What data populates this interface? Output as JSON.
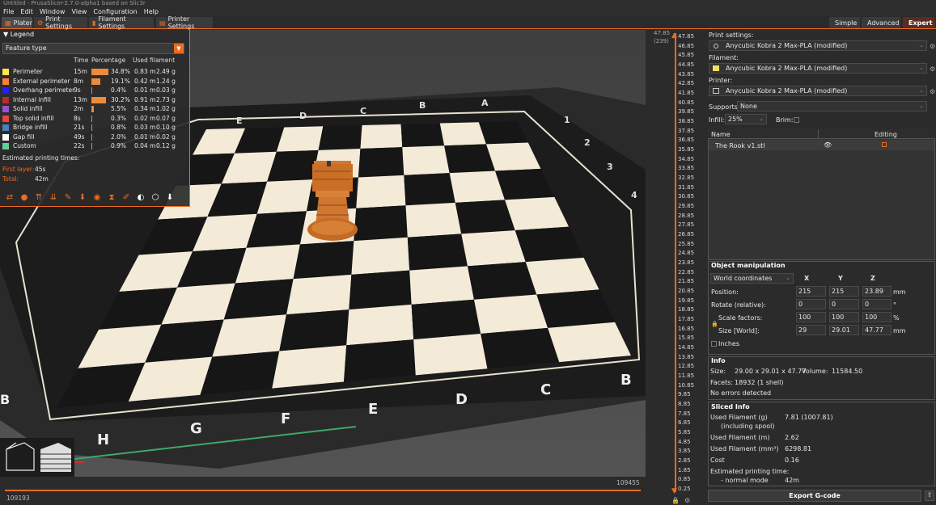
{
  "window": {
    "title": "Untitled - PrusaSlicer-2.7.0-alpha1 based on Slic3r"
  },
  "menu": [
    "File",
    "Edit",
    "Window",
    "View",
    "Configuration",
    "Help"
  ],
  "tabs": [
    {
      "label": "Plater",
      "active": true
    },
    {
      "label": "Print Settings",
      "active": false
    },
    {
      "label": "Filament Settings",
      "active": false
    },
    {
      "label": "Printer Settings",
      "active": false
    }
  ],
  "modes": {
    "simple": "Simple",
    "advanced": "Advanced",
    "expert": "Expert"
  },
  "legend": {
    "title": "Legend",
    "view_type": "Feature type",
    "columns": {
      "time": "Time",
      "percentage": "Percentage",
      "used": "Used filament"
    },
    "rows": [
      {
        "name": "Perimeter",
        "time": "15m",
        "pct": "34.8%",
        "pct_value": 34.8,
        "m": "0.83 m",
        "g": "2.49 g",
        "color": "#FFE64D"
      },
      {
        "name": "External perimeter",
        "time": "8m",
        "pct": "19.1%",
        "pct_value": 19.1,
        "m": "0.42 m",
        "g": "1.24 g",
        "color": "#FF7D38"
      },
      {
        "name": "Overhang perimeter",
        "time": "9s",
        "pct": "0.4%",
        "pct_value": 0.4,
        "m": "0.01 m",
        "g": "0.03 g",
        "color": "#1F1FFF"
      },
      {
        "name": "Internal infill",
        "time": "13m",
        "pct": "30.2%",
        "pct_value": 30.2,
        "m": "0.91 m",
        "g": "2.73 g",
        "color": "#B03029"
      },
      {
        "name": "Solid infill",
        "time": "2m",
        "pct": "5.5%",
        "pct_value": 5.5,
        "m": "0.34 m",
        "g": "1.02 g",
        "color": "#9654CC"
      },
      {
        "name": "Top solid infill",
        "time": "8s",
        "pct": "0.3%",
        "pct_value": 0.3,
        "m": "0.02 m",
        "g": "0.07 g",
        "color": "#F04040"
      },
      {
        "name": "Bridge infill",
        "time": "21s",
        "pct": "0.8%",
        "pct_value": 0.8,
        "m": "0.03 m",
        "g": "0.10 g",
        "color": "#4D80BA"
      },
      {
        "name": "Gap fill",
        "time": "49s",
        "pct": "2.0%",
        "pct_value": 2.0,
        "m": "0.01 m",
        "g": "0.02 g",
        "color": "#FFFFFF"
      },
      {
        "name": "Custom",
        "time": "22s",
        "pct": "0.9%",
        "pct_value": 0.9,
        "m": "0.04 m",
        "g": "0.12 g",
        "color": "#5ED194"
      }
    ],
    "estimated_title": "Estimated printing times:",
    "first_layer_label": "First layer:",
    "first_layer_value": "45s",
    "total_label": "Total:",
    "total_value": "42m"
  },
  "board_letters_top": [
    "E",
    "D",
    "C",
    "B",
    "A"
  ],
  "board_numbers_right": [
    "1",
    "2",
    "3",
    "4"
  ],
  "board_letters_bottom": [
    "H",
    "G",
    "F",
    "E",
    "D",
    "C",
    "B"
  ],
  "board_left": [
    "B",
    "F"
  ],
  "layer_slider": {
    "top_value": "47.85",
    "top_layer": "(239)",
    "ticks": [
      "47.85",
      "46.85",
      "45.85",
      "44.85",
      "43.85",
      "42.85",
      "41.85",
      "40.85",
      "39.85",
      "38.85",
      "37.85",
      "36.85",
      "35.85",
      "34.85",
      "33.85",
      "32.85",
      "31.85",
      "30.85",
      "29.85",
      "28.85",
      "27.85",
      "26.85",
      "25.85",
      "24.85",
      "23.85",
      "22.85",
      "21.85",
      "20.85",
      "19.85",
      "18.85",
      "17.85",
      "16.85",
      "15.85",
      "14.85",
      "13.85",
      "12.85",
      "11.85",
      "10.85",
      "9.85",
      "8.85",
      "7.85",
      "6.85",
      "5.85",
      "4.85",
      "3.85",
      "2.85",
      "1.85",
      "0.85",
      "0.25"
    ],
    "bottom_value": "0.25"
  },
  "move_slider": {
    "left": "109193",
    "right": "109455"
  },
  "right_panel": {
    "print_settings_label": "Print settings:",
    "print_settings_value": "Anycubic Kobra 2 Max-PLA (modified)",
    "filament_label": "Filament:",
    "filament_value": "Anycubic Kobra 2 Max-PLA (modified)",
    "printer_label": "Printer:",
    "printer_value": "Anycubic Kobra 2 Max-PLA (modified)",
    "supports_label": "Supports:",
    "supports_value": "None",
    "infill_label": "Infill:",
    "infill_value": "25%",
    "brim_label": "Brim:",
    "list_cols": {
      "name": "Name",
      "editing": "Editing"
    },
    "objects": [
      "The Rook v1.stl"
    ],
    "object_manipulation": {
      "title": "Object manipulation",
      "coords": "World coordinates",
      "axes": [
        "X",
        "Y",
        "Z"
      ],
      "position_label": "Position:",
      "position": [
        "215",
        "215",
        "23.89"
      ],
      "position_unit": "mm",
      "rotate_label": "Rotate (relative):",
      "rotate": [
        "0",
        "0",
        "0"
      ],
      "rotate_unit": "°",
      "scale_label": "Scale factors:",
      "scale": [
        "100",
        "100",
        "100"
      ],
      "scale_unit": "%",
      "size_label": "Size [World]:",
      "size": [
        "29",
        "29.01",
        "47.77"
      ],
      "size_unit": "mm",
      "inches_label": "Inches"
    },
    "info": {
      "title": "Info",
      "size_label": "Size:",
      "size_value": "29.00 x 29.01 x 47.77",
      "volume_label": "Volume:",
      "volume_value": "11584.50",
      "facets_label": "Facets:",
      "facets_value": "18932 (1 shell)",
      "errors": "No errors detected"
    },
    "sliced_info": {
      "title": "Sliced Info",
      "rows": [
        {
          "label": "Used Filament (g)",
          "value": "7.81 (1007.81)"
        },
        {
          "label": "(including spool)",
          "value": ""
        },
        {
          "label": "Used Filament (m)",
          "value": "2.62"
        },
        {
          "label": "Used Filament (mm³)",
          "value": "6298.81"
        },
        {
          "label": "Cost",
          "value": "0.16"
        },
        {
          "label": "Estimated printing time:",
          "value": ""
        },
        {
          "label": "- normal mode",
          "value": "42m"
        }
      ]
    },
    "export_label": "Export G-code"
  }
}
